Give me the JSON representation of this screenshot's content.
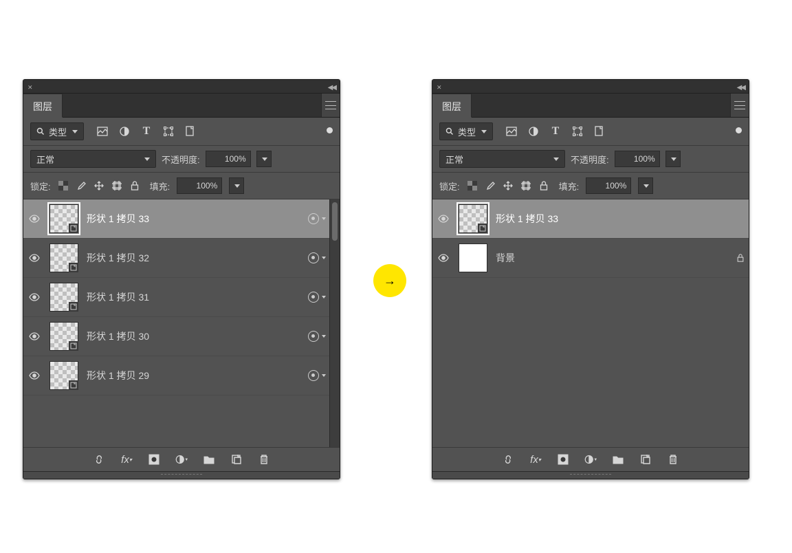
{
  "arrow_glyph": "→",
  "panels": [
    {
      "tab_label": "图层",
      "type_filter_label": "类型",
      "blend_mode": "正常",
      "opacity_label": "不透明度:",
      "opacity_value": "100%",
      "lock_label": "锁定:",
      "fill_label": "填充:",
      "fill_value": "100%",
      "has_scrollbar": true,
      "layers": [
        {
          "name": "形状 1 拷贝 33",
          "selected": true,
          "type": "shape",
          "hasAdvanced": true
        },
        {
          "name": "形状 1 拷贝 32",
          "selected": false,
          "type": "shape",
          "hasAdvanced": true
        },
        {
          "name": "形状 1 拷贝 31",
          "selected": false,
          "type": "shape",
          "hasAdvanced": true
        },
        {
          "name": "形状 1 拷贝 30",
          "selected": false,
          "type": "shape",
          "hasAdvanced": true
        },
        {
          "name": "形状 1 拷贝 29",
          "selected": false,
          "type": "shape",
          "hasAdvanced": true
        }
      ]
    },
    {
      "tab_label": "图层",
      "type_filter_label": "类型",
      "blend_mode": "正常",
      "opacity_label": "不透明度:",
      "opacity_value": "100%",
      "lock_label": "锁定:",
      "fill_label": "填充:",
      "fill_value": "100%",
      "has_scrollbar": false,
      "layers": [
        {
          "name": "形状 1 拷贝 33",
          "selected": true,
          "type": "shape",
          "hasAdvanced": false
        },
        {
          "name": "背景",
          "selected": false,
          "type": "bg",
          "locked": true
        }
      ]
    }
  ],
  "icons": {
    "search": "search-icon",
    "image_filter": "image-filon",
    "adjust": "contrast-icon",
    "text": "T",
    "path": "path-icon",
    "smart": "smart-icon"
  }
}
